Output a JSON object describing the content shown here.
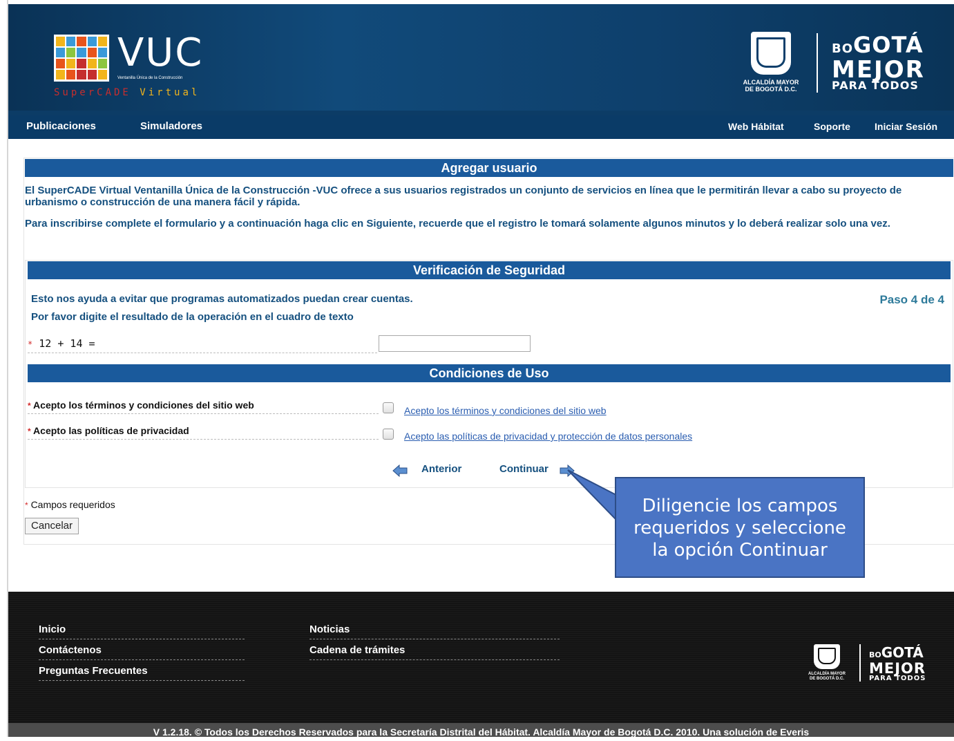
{
  "header": {
    "logo_text": "VUC",
    "logo_subtitle": "Ventanilla Única de la Construcción",
    "logo_tagline_red": "SuperCADE",
    "logo_tagline_yellow": "Virtual",
    "alcaldia_line1": "ALCALDÍA MAYOR",
    "alcaldia_line2": "DE BOGOTÁ D.C.",
    "bogota_line1_small": "BO",
    "bogota_line1": "GOTÁ",
    "bogota_line2": "MEJOR",
    "bogota_line3": "PARA TODOS"
  },
  "nav": {
    "left": [
      "Publicaciones",
      "Simuladores"
    ],
    "right": [
      "Web Hábitat",
      "Soporte",
      "Iniciar Sesión"
    ]
  },
  "page": {
    "title": "Agregar usuario",
    "intro1": "El SuperCADE Virtual Ventanilla Única de la Construcción -VUC ofrece a sus usuarios registrados un conjunto de servicios en línea que le permitirán llevar a cabo su proyecto de urbanismo o construcción de una manera fácil y rápida.",
    "intro2": "Para inscribirse complete el formulario y a continuación haga clic en Siguiente, recuerde que el registro le tomará solamente algunos minutos y lo deberá realizar solo una vez."
  },
  "verification": {
    "title": "Verificación de Seguridad",
    "line1": "Esto nos ayuda a evitar que programas automatizados puedan crear cuentas.",
    "line2": "Por favor digite el resultado de la operación en el cuadro de texto",
    "step": "Paso 4 de 4",
    "captcha_label": "12 + 14 =",
    "captcha_value": ""
  },
  "conditions": {
    "title": "Condiciones de Uso",
    "terms_label": "Acepto los términos y condiciones del sitio web",
    "terms_link": "Acepto los términos y condiciones del sitio web",
    "privacy_label": "Acepto las políticas de privacidad",
    "privacy_link": "Acepto las políticas de privacidad y protección de datos personales"
  },
  "buttons": {
    "previous": "Anterior",
    "continue": "Continuar",
    "cancel": "Cancelar"
  },
  "required_note": "Campos requeridos",
  "callout": {
    "line1": "Diligencie los campos",
    "line2": "requeridos y seleccione",
    "line3": "la opción Continuar"
  },
  "footer": {
    "links_col1": [
      "Inicio",
      "Contáctenos",
      "Preguntas Frecuentes"
    ],
    "links_col2": [
      "Noticias",
      "Cadena de trámites"
    ],
    "alcaldia_line1": "ALCALDÍA MAYOR",
    "alcaldia_line2": "DE BOGOTÁ D.C.",
    "copyright": "V 1.2.18. © Todos los Derechos Reservados para la Secretaría Distrital del Hábitat. Alcaldía Mayor de Bogotá D.C. 2010. Una solución de Everis"
  },
  "colors": {
    "header_blue": "#0a3b67",
    "section_blue": "#1a5a9c",
    "text_blue": "#15507f",
    "required_red": "#d32b2b",
    "callout_blue": "#4a74c4",
    "footer_black": "#141414"
  }
}
